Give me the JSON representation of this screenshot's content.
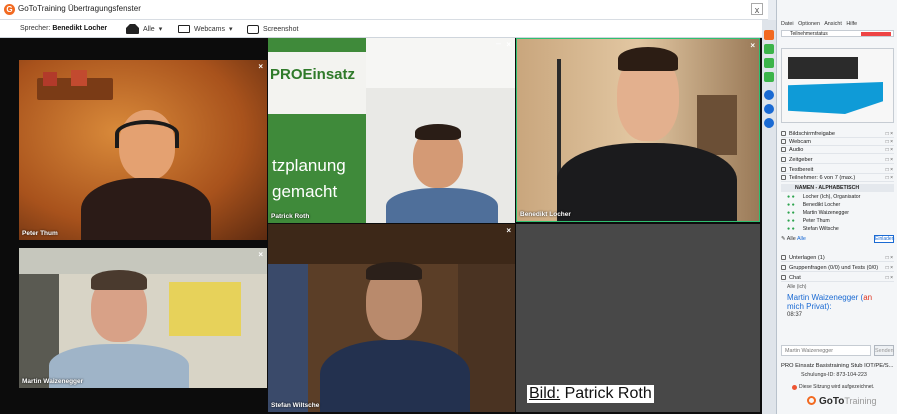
{
  "window": {
    "title": "GoToTraining Übertragungsfenster",
    "close": "x"
  },
  "toolbar": {
    "speaker_label": "Sprecher:",
    "speaker_name": "Benedikt Locher",
    "people_label": "Alle",
    "webcams_label": "Webcams",
    "screenshot_label": "Screenshot"
  },
  "tiles": [
    {
      "name": "Peter Thum"
    },
    {
      "name": "Patrick Roth"
    },
    {
      "name": "Benedikt Locher"
    },
    {
      "name": "Martin Waizenegger"
    },
    {
      "name": "Stefan Wiltsche"
    }
  ],
  "banner": {
    "brand": "PROEinsatz",
    "line1": "tzplanung",
    "line2": "gemacht"
  },
  "caption": {
    "label": "Bild:",
    "text": "Patrick Roth"
  },
  "panel": {
    "menu": [
      "Datei",
      "Optionen",
      "Ansicht",
      "Hilfe"
    ],
    "participants_bar": "Teilnehmerstatus",
    "rows": [
      "Bildschirmfreigabe",
      "Webcam",
      "Audio",
      "Zeitgeber",
      "Testbereit",
      "Teilnehmer: 6 von 7 (max.)"
    ],
    "people_header": "NAMEN - ALPHABETISCH",
    "people": [
      "Locher (Ich), Organisator",
      "Benedikt Locher",
      "Martin Waizenegger",
      "Peter Thum",
      "Stefan Wiltsche"
    ],
    "rec_text": "Alle",
    "rec_link": "Alle",
    "invite": "Einladen",
    "sections": [
      "Unterlagen (1)",
      "Gruppenfragen (0/0) und Tests (0/0)",
      "Chat"
    ],
    "chat_meta": "Alle (ich)",
    "chat_from": "Martin Waizenegger",
    "chat_to": "an",
    "chat_target": "mich",
    "chat_target2": "Privat",
    "chat_time": "08:37",
    "chat_input_placeholder": "Martin Waizenegger",
    "send": "Senden",
    "session_title": "PRO Einsatz  Basistraining Stub  IOT/PE/S...",
    "session_id": "Schulungs-ID: 873-104-223",
    "session_note": "Diese Sitzung wird aufgezeichnet.",
    "brand": "GoTo",
    "brand_sub": "Training"
  },
  "colors": {
    "accent_orange": "#f26a21",
    "link_blue": "#1a6ad3",
    "banner_green": "#3f8a3a"
  }
}
